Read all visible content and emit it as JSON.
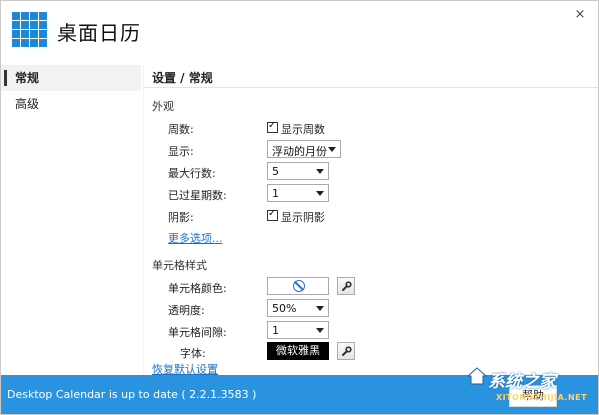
{
  "app": {
    "title": "桌面日历",
    "close_symbol": "×"
  },
  "sidebar": {
    "items": [
      {
        "label": "常规",
        "active": true
      },
      {
        "label": "高级",
        "active": false
      }
    ]
  },
  "main": {
    "page_title": "设置 / 常规",
    "appearance": {
      "section_title": "外观",
      "week_numbers": {
        "label": "周数:",
        "checkbox_label": "显示周数",
        "checked": true
      },
      "display": {
        "label": "显示:",
        "value": "浮动的月份"
      },
      "max_rows": {
        "label": "最大行数:",
        "value": "5"
      },
      "past_weeks": {
        "label": "已过星期数:",
        "value": "1"
      },
      "shadow": {
        "label": "阴影:",
        "checkbox_label": "显示阴影",
        "checked": true
      },
      "more_link": "更多选项..."
    },
    "cell_style": {
      "section_title": "单元格样式",
      "cell_color": {
        "label": "单元格颜色:",
        "icon": "no-color-icon"
      },
      "opacity": {
        "label": "透明度:",
        "value": "50%"
      },
      "cell_spacing": {
        "label": "单元格间隙:",
        "value": "1"
      },
      "font": {
        "label": "字体:",
        "value": "微软雅黑"
      },
      "restore_link": "恢复默认设置"
    }
  },
  "footer": {
    "status": "Desktop Calendar is up to date ( 2.2.1.3583 )",
    "button": "帮助"
  },
  "watermark": {
    "text": "系统之家",
    "sub": "XITONGZHIJIA.NET"
  },
  "colors": {
    "accent": "#2a93e0",
    "logo": "#1e88d6",
    "link": "#1a73c8"
  }
}
